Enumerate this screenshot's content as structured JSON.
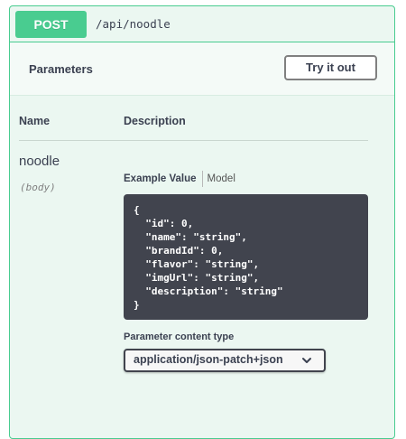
{
  "operation": {
    "method": "POST",
    "path": "/api/noodle"
  },
  "parameters_section": {
    "title": "Parameters",
    "try_button_label": "Try it out",
    "columns": {
      "name": "Name",
      "description": "Description"
    },
    "parameter": {
      "name": "noodle",
      "location": "(body)"
    }
  },
  "example": {
    "tab_active": "Example Value",
    "tab_inactive": "Model",
    "code": "{\n  \"id\": 0,\n  \"name\": \"string\",\n  \"brandId\": 0,\n  \"flavor\": \"string\",\n  \"imgUrl\": \"string\",\n  \"description\": \"string\"\n}"
  },
  "content_type": {
    "label": "Parameter content type",
    "selected": "application/json-patch+json"
  },
  "colors": {
    "post_accent": "#49cc90",
    "post_background": "#ebf7f1",
    "code_background": "#41444e",
    "text": "#3b4151"
  },
  "icons": {
    "select": "chevron-down-icon"
  }
}
